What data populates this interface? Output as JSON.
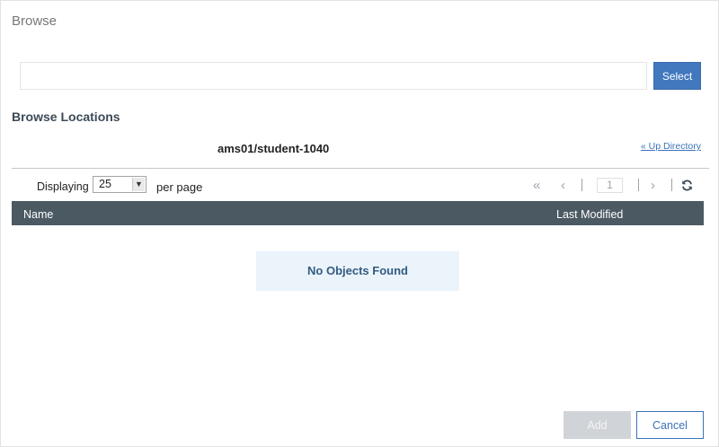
{
  "dialog": {
    "title": "Browse",
    "path_input": {
      "value": "",
      "placeholder": ""
    },
    "select_label": "Select",
    "section_heading": "Browse Locations",
    "current_location": "ams01/student-1040",
    "up_directory_label": "« Up Directory"
  },
  "pagination": {
    "displaying_label": "Displaying",
    "page_size": "25",
    "page_size_options": [
      "25"
    ],
    "per_page_label": "per page",
    "first_icon": "«",
    "prev_icon": "‹",
    "current_page": "1",
    "next_icon": "›",
    "refresh_icon": "refresh-icon"
  },
  "table": {
    "columns": [
      "Name",
      "Last Modified"
    ],
    "rows": [],
    "empty_message": "No Objects Found"
  },
  "footer": {
    "add_label": "Add",
    "cancel_label": "Cancel"
  },
  "colors": {
    "primary": "#4178be",
    "table_header": "#4b5963",
    "empty_bg": "#ebf3fb",
    "disabled": "#d0d4d8"
  }
}
